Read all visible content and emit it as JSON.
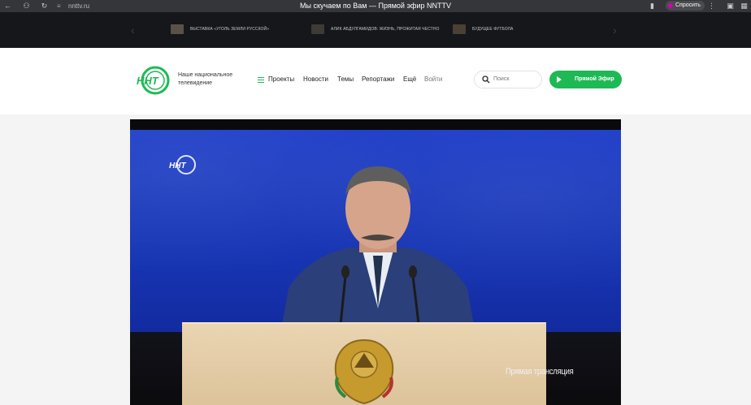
{
  "browser": {
    "url": "nnttv.ru",
    "title": "Мы скучаем по Вам — Прямой эфир NNTTV",
    "ask_label": "Спросить"
  },
  "ticker": {
    "items": [
      {
        "label": "ВЫСТАВКА «УГОЛЬ ЗЕМЛИ РУССКОЙ»"
      },
      {
        "label": "АЛИК АБДУЛГАМИДОВ: ЖИЗНЬ, ПРОЖИТАЯ ЧЕСТНО"
      },
      {
        "label": "БУДУЩЕЕ ФУТБОЛА"
      }
    ]
  },
  "header": {
    "logo_text": "ННТ",
    "slogan": "Наше национальное телевидение",
    "nav": {
      "projects": "Проекты",
      "news": "Новости",
      "topics": "Темы",
      "reports": "Репортажи",
      "more": "Ещё",
      "login": "Войти"
    },
    "search_placeholder": "Поиск",
    "live_button": "Прямой Эфир"
  },
  "video": {
    "watermark": "ННТ",
    "caption": "Прямая трансляция"
  },
  "colors": {
    "accent": "#1db954",
    "ticker_bg": "#15171a",
    "chrome_bg": "#35363a",
    "video_blue": "#1f3fc8"
  }
}
